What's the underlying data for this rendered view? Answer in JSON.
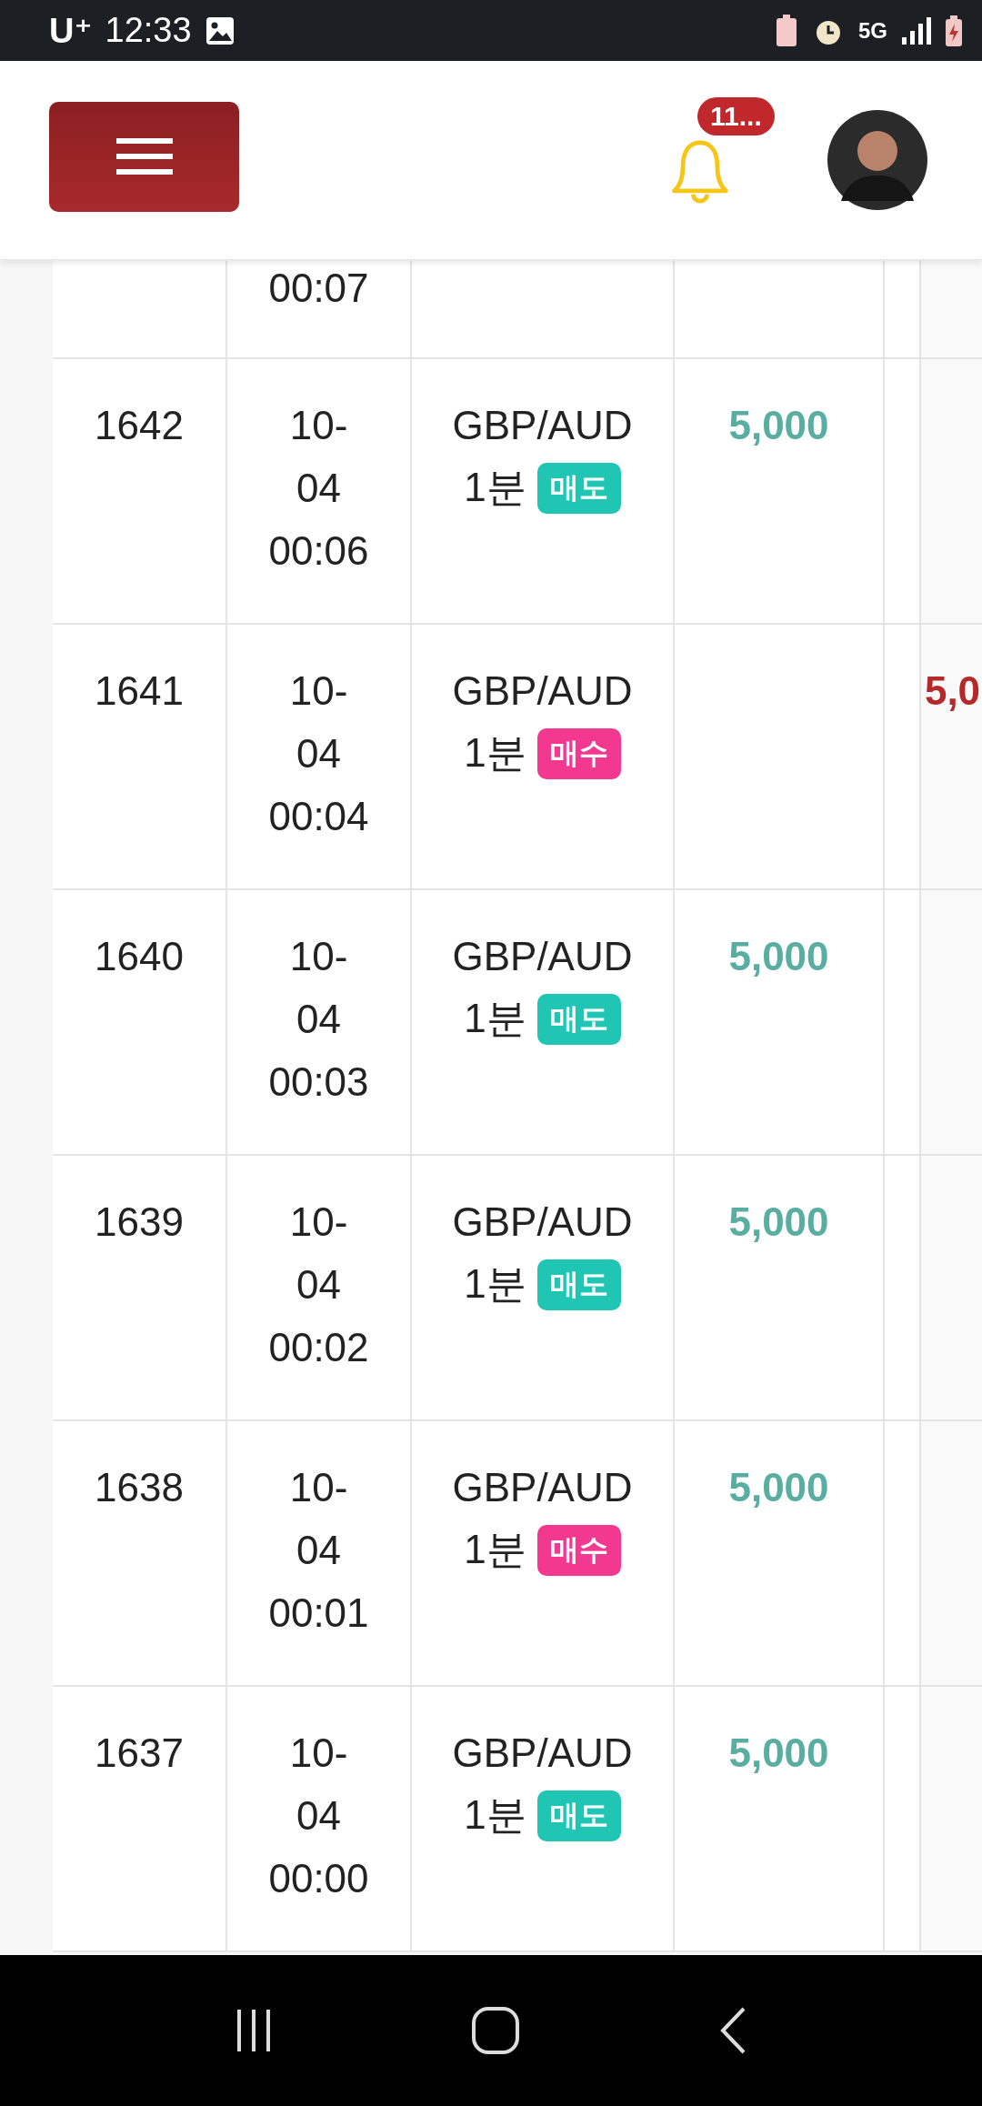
{
  "status_bar": {
    "carrier": "U⁺",
    "time": "12:33",
    "network": "5G"
  },
  "header": {
    "notification_count": "11..."
  },
  "table": {
    "partial_row": {
      "date_lines": [
        "00:07"
      ]
    },
    "rows": [
      {
        "id": "1642",
        "date_lines": [
          "10-",
          "04",
          "00:06"
        ],
        "pair": "GBP/AUD",
        "period": "1분",
        "side_label": "매도",
        "color": "#20c6b3",
        "profit": "5,000"
      },
      {
        "id": "1641",
        "date_lines": [
          "10-",
          "04",
          "00:04"
        ],
        "pair": "GBP/AUD",
        "period": "1분",
        "side_label": "매수",
        "color": "#f2388f",
        "loss": "5,0"
      },
      {
        "id": "1640",
        "date_lines": [
          "10-",
          "04",
          "00:03"
        ],
        "pair": "GBP/AUD",
        "period": "1분",
        "side_label": "매도",
        "color": "#20c6b3",
        "profit": "5,000"
      },
      {
        "id": "1639",
        "date_lines": [
          "10-",
          "04",
          "00:02"
        ],
        "pair": "GBP/AUD",
        "period": "1분",
        "side_label": "매도",
        "color": "#20c6b3",
        "profit": "5,000"
      },
      {
        "id": "1638",
        "date_lines": [
          "10-",
          "04",
          "00:01"
        ],
        "pair": "GBP/AUD",
        "period": "1분",
        "side_label": "매수",
        "color": "#f2388f",
        "profit": "5,000"
      },
      {
        "id": "1637",
        "date_lines": [
          "10-",
          "04",
          "00:00"
        ],
        "pair": "GBP/AUD",
        "period": "1분",
        "side_label": "매도",
        "color": "#20c6b3",
        "profit": "5,000"
      }
    ]
  }
}
